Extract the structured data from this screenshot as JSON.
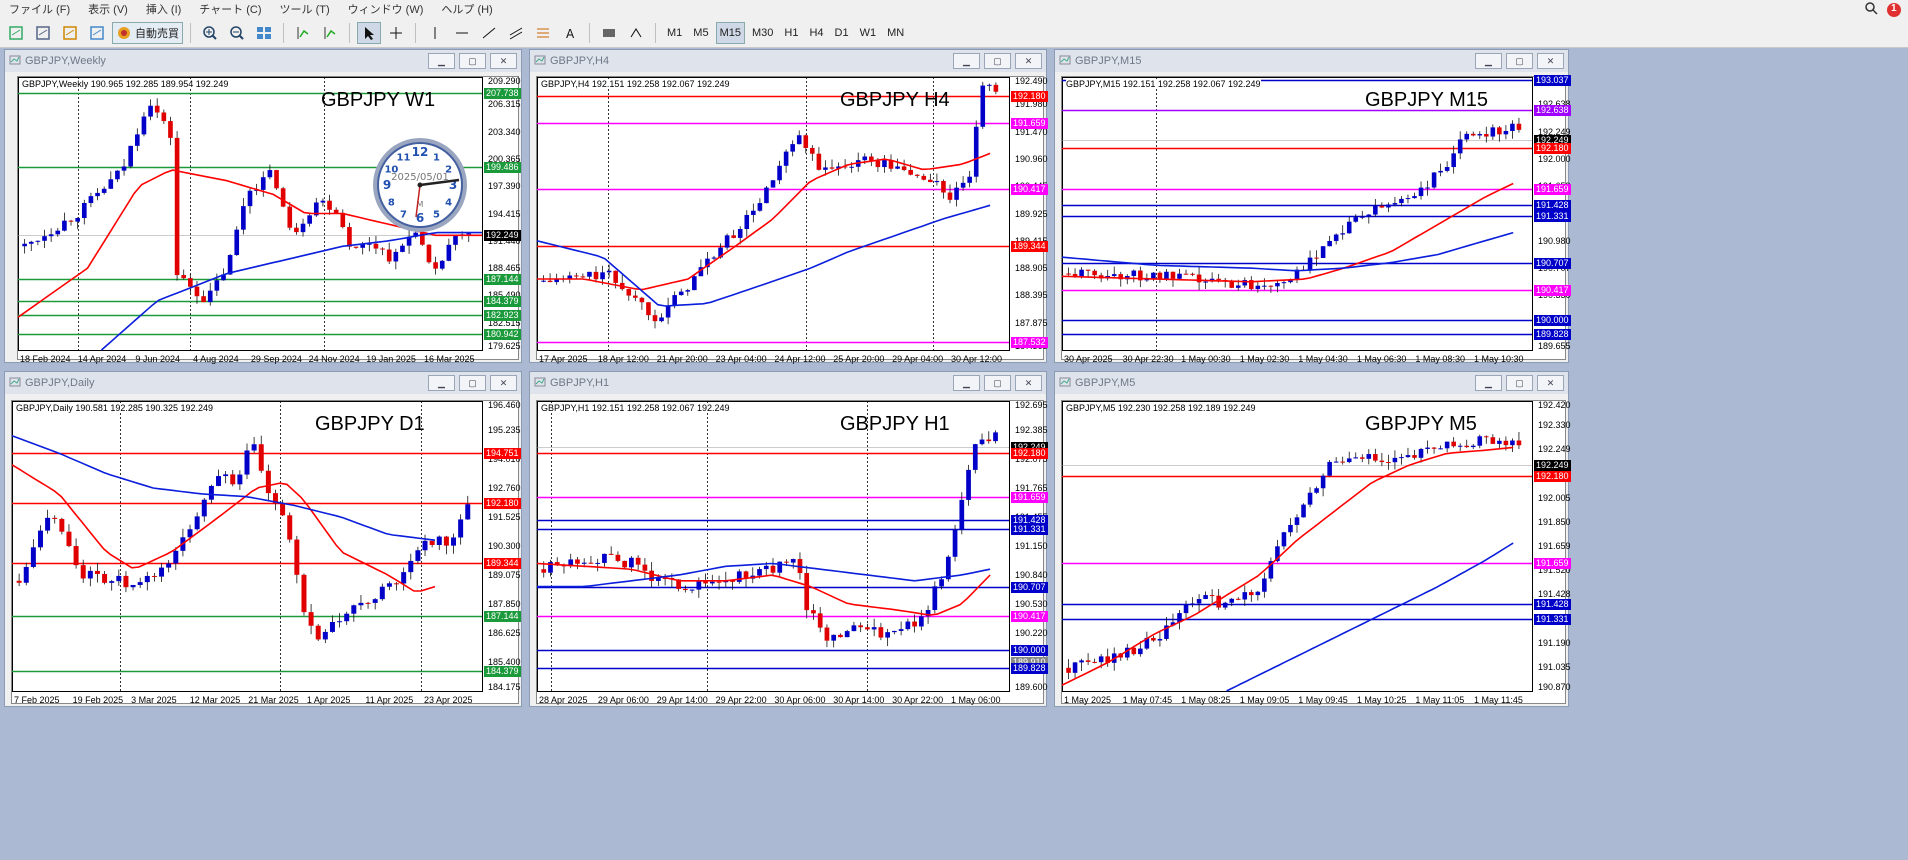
{
  "menu": [
    "ファイル (F)",
    "表示 (V)",
    "挿入 (I)",
    "チャート (C)",
    "ツール (T)",
    "ウィンドウ (W)",
    "ヘルプ (H)"
  ],
  "toolbar": {
    "autotrade": "自動売買",
    "timeframes": [
      "M1",
      "M5",
      "M15",
      "M30",
      "H1",
      "H4",
      "D1",
      "W1",
      "MN"
    ],
    "active_tf": "M15"
  },
  "notify_count": "1",
  "colors": {
    "up": "#0000c8",
    "down": "#e00000",
    "ma_fast": "#ff0000",
    "ma_slow": "#0a1edc",
    "grid": "#000000"
  },
  "clock": {
    "date": "2025/05/01",
    "letter": "M"
  },
  "windows": [
    {
      "id": "w1",
      "title": "GBPJPY,Weekly",
      "info": "GBPJPY,Weekly  190.965 192.285 189.954 192.249",
      "label": "GBPJPY W1",
      "yticks": [
        "209.290",
        "206.315",
        "203.340",
        "200.365",
        "197.390",
        "194.415",
        "191.440",
        "188.465",
        "185.490",
        "182.515",
        "179.625"
      ],
      "tags": [
        {
          "text": "207.738",
          "color": "#1a9a3a"
        },
        {
          "text": "199.486",
          "color": "#1a9a3a"
        },
        {
          "text": "192.249",
          "color": "#000000"
        },
        {
          "text": "187.144",
          "color": "#1a9a3a"
        },
        {
          "text": "184.379",
          "color": "#1a9a3a"
        },
        {
          "text": "182.923",
          "color": "#1a9a3a"
        },
        {
          "text": "180.942",
          "color": "#1a9a3a"
        }
      ],
      "xlabels": [
        "18 Feb 2024",
        "14 Apr 2024",
        "9 Jun 2024",
        "4 Aug 2024",
        "29 Sep 2024",
        "24 Nov 2024",
        "19 Jan 2025",
        "16 Mar 2025"
      ]
    },
    {
      "id": "h4",
      "title": "GBPJPY,H4",
      "info": "GBPJPY,H4  192.151 192.258 192.067 192.249",
      "label": "GBPJPY H4",
      "yticks": [
        "192.490",
        "191.980",
        "191.470",
        "190.960",
        "190.445",
        "189.925",
        "189.415",
        "188.905",
        "188.395",
        "187.875",
        "187.365"
      ],
      "tags": [
        {
          "text": "192.180",
          "color": "#ff0000"
        },
        {
          "text": "191.659",
          "color": "#ff00ff"
        },
        {
          "text": "190.417",
          "color": "#ff00ff"
        },
        {
          "text": "189.344",
          "color": "#ff0000"
        },
        {
          "text": "187.532",
          "color": "#ff00ff"
        }
      ],
      "xlabels": [
        "17 Apr 2025",
        "18 Apr 12:00",
        "21 Apr 20:00",
        "23 Apr 04:00",
        "24 Apr 12:00",
        "25 Apr 20:00",
        "29 Apr 04:00",
        "30 Apr 12:00"
      ]
    },
    {
      "id": "m15",
      "title": "GBPJPY,M15",
      "info": "GBPJPY,M15  192.151 192.258 192.067 192.249",
      "label": "GBPJPY M15",
      "yticks": [
        "193.037",
        "192.638",
        "192.249",
        "192.000",
        "191.659",
        "191.331",
        "190.980",
        "190.707",
        "190.330",
        "189.980",
        "189.655"
      ],
      "tags": [
        {
          "text": "193.037",
          "color": "#0000c8"
        },
        {
          "text": "192.638",
          "color": "#a000ff"
        },
        {
          "text": "192.249",
          "color": "#000000"
        },
        {
          "text": "192.180",
          "color": "#ff0000"
        },
        {
          "text": "191.659",
          "color": "#ff00ff"
        },
        {
          "text": "191.428",
          "color": "#0000c8"
        },
        {
          "text": "191.331",
          "color": "#0000c8"
        },
        {
          "text": "190.707",
          "color": "#0000c8"
        },
        {
          "text": "190.417",
          "color": "#ff00ff"
        },
        {
          "text": "190.000",
          "color": "#0000c8"
        },
        {
          "text": "189.828",
          "color": "#0000c8"
        }
      ],
      "xlabels": [
        "30 Apr 2025",
        "30 Apr 22:30",
        "1 May 00:30",
        "1 May 02:30",
        "1 May 04:30",
        "1 May 06:30",
        "1 May 08:30",
        "1 May 10:30"
      ]
    },
    {
      "id": "d1",
      "title": "GBPJPY,Daily",
      "info": "GBPJPY,Daily  190.581 192.285 190.325 192.249",
      "label": "GBPJPY D1",
      "yticks": [
        "196.460",
        "195.235",
        "194.010",
        "192.760",
        "191.525",
        "190.300",
        "189.075",
        "187.850",
        "186.625",
        "185.400",
        "184.175"
      ],
      "tags": [
        {
          "text": "194.751",
          "color": "#ff0000"
        },
        {
          "text": "192.180",
          "color": "#ff0000"
        },
        {
          "text": "189.344",
          "color": "#ff0000"
        },
        {
          "text": "187.144",
          "color": "#1a9a3a"
        },
        {
          "text": "184.379",
          "color": "#1a9a3a"
        }
      ],
      "xlabels": [
        "7 Feb 2025",
        "19 Feb 2025",
        "3 Mar 2025",
        "12 Mar 2025",
        "21 Mar 2025",
        "1 Apr 2025",
        "11 Apr 2025",
        "23 Apr 2025"
      ]
    },
    {
      "id": "h1",
      "title": "GBPJPY,H1",
      "info": "GBPJPY,H1  192.151 192.258 192.067 192.249",
      "label": "GBPJPY H1",
      "yticks": [
        "192.695",
        "192.385",
        "192.075",
        "191.765",
        "191.455",
        "191.150",
        "190.840",
        "190.530",
        "190.220",
        "189.910",
        "189.600"
      ],
      "tags": [
        {
          "text": "192.249",
          "color": "#000000"
        },
        {
          "text": "192.180",
          "color": "#ff0000"
        },
        {
          "text": "191.659",
          "color": "#ff00ff"
        },
        {
          "text": "191.428",
          "color": "#0000c8"
        },
        {
          "text": "191.331",
          "color": "#0000c8"
        },
        {
          "text": "190.707",
          "color": "#0000c8"
        },
        {
          "text": "190.417",
          "color": "#ff00ff"
        },
        {
          "text": "190.000",
          "color": "#0000c8"
        },
        {
          "text": "189.910",
          "color": "#888888"
        },
        {
          "text": "189.828",
          "color": "#0000c8"
        }
      ],
      "xlabels": [
        "28 Apr 2025",
        "29 Apr 06:00",
        "29 Apr 14:00",
        "29 Apr 22:00",
        "30 Apr 06:00",
        "30 Apr 14:00",
        "30 Apr 22:00",
        "1 May 06:00"
      ]
    },
    {
      "id": "m5",
      "title": "GBPJPY,M5",
      "info": "GBPJPY,M5  192.230 192.258 192.189 192.249",
      "label": "GBPJPY M5",
      "yticks": [
        "192.420",
        "192.330",
        "192.249",
        "192.180",
        "192.005",
        "191.850",
        "191.659",
        "191.520",
        "191.428",
        "191.331",
        "191.190",
        "191.035",
        "190.870"
      ],
      "tags": [
        {
          "text": "192.249",
          "color": "#000000"
        },
        {
          "text": "192.180",
          "color": "#ff0000"
        },
        {
          "text": "191.659",
          "color": "#ff00ff"
        },
        {
          "text": "191.428",
          "color": "#0000c8"
        },
        {
          "text": "191.331",
          "color": "#0000c8"
        }
      ],
      "xlabels": [
        "1 May 2025",
        "1 May 07:45",
        "1 May 08:25",
        "1 May 09:05",
        "1 May 09:45",
        "1 May 10:25",
        "1 May 11:05",
        "1 May 11:45"
      ]
    }
  ]
}
